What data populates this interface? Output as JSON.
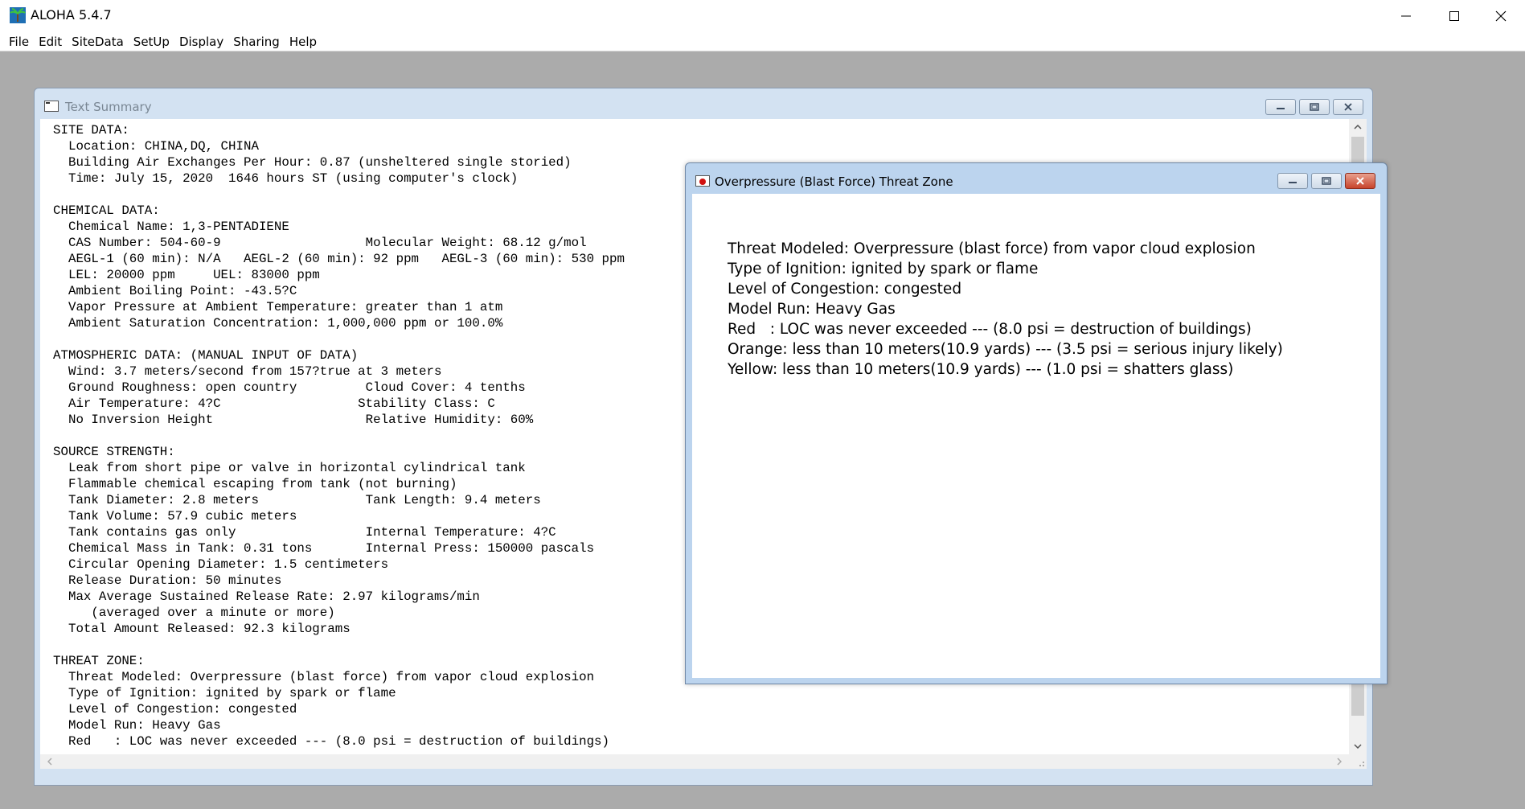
{
  "app": {
    "title": "ALOHA 5.4.7",
    "menu": [
      "File",
      "Edit",
      "SiteData",
      "SetUp",
      "Display",
      "Sharing",
      "Help"
    ]
  },
  "summary_window": {
    "title": "Text Summary",
    "lines": [
      "SITE DATA:",
      "  Location: CHINA,DQ, CHINA",
      "  Building Air Exchanges Per Hour: 0.87 (unsheltered single storied)",
      "  Time: July 15, 2020  1646 hours ST (using computer's clock)",
      "",
      "CHEMICAL DATA:",
      "  Chemical Name: 1,3-PENTADIENE",
      "  CAS Number: 504-60-9                   Molecular Weight: 68.12 g/mol",
      "  AEGL-1 (60 min): N/A   AEGL-2 (60 min): 92 ppm   AEGL-3 (60 min): 530 ppm",
      "  LEL: 20000 ppm     UEL: 83000 ppm",
      "  Ambient Boiling Point: -43.5?C",
      "  Vapor Pressure at Ambient Temperature: greater than 1 atm",
      "  Ambient Saturation Concentration: 1,000,000 ppm or 100.0%",
      "",
      "ATMOSPHERIC DATA: (MANUAL INPUT OF DATA)",
      "  Wind: 3.7 meters/second from 157?true at 3 meters",
      "  Ground Roughness: open country         Cloud Cover: 4 tenths",
      "  Air Temperature: 4?C                  Stability Class: C",
      "  No Inversion Height                    Relative Humidity: 60%",
      "",
      "SOURCE STRENGTH:",
      "  Leak from short pipe or valve in horizontal cylindrical tank",
      "  Flammable chemical escaping from tank (not burning)",
      "  Tank Diameter: 2.8 meters              Tank Length: 9.4 meters",
      "  Tank Volume: 57.9 cubic meters",
      "  Tank contains gas only                 Internal Temperature: 4?C",
      "  Chemical Mass in Tank: 0.31 tons       Internal Press: 150000 pascals",
      "  Circular Opening Diameter: 1.5 centimeters",
      "  Release Duration: 50 minutes",
      "  Max Average Sustained Release Rate: 2.97 kilograms/min",
      "     (averaged over a minute or more)",
      "  Total Amount Released: 92.3 kilograms",
      "",
      "THREAT ZONE:",
      "  Threat Modeled: Overpressure (blast force) from vapor cloud explosion",
      "  Type of Ignition: ignited by spark or flame",
      "  Level of Congestion: congested",
      "  Model Run: Heavy Gas",
      "  Red   : LOC was never exceeded --- (8.0 psi = destruction of buildings)"
    ]
  },
  "threat_window": {
    "title": "Overpressure (Blast Force) Threat Zone",
    "lines": [
      "Threat Modeled: Overpressure (blast force) from vapor cloud explosion",
      "Type of Ignition: ignited by spark or flame",
      "Level of Congestion: congested",
      "Model Run: Heavy Gas",
      "Red   : LOC was never exceeded --- (8.0 psi = destruction of buildings)",
      "Orange: less than 10 meters(10.9 yards) --- (3.5 psi = serious injury likely)",
      "Yellow: less than 10 meters(10.9 yards) --- (1.0 psi = shatters glass)"
    ]
  },
  "icons": {
    "app": "palm-tree-icon",
    "summary": "document-icon",
    "threat": "threat-zone-icon"
  }
}
